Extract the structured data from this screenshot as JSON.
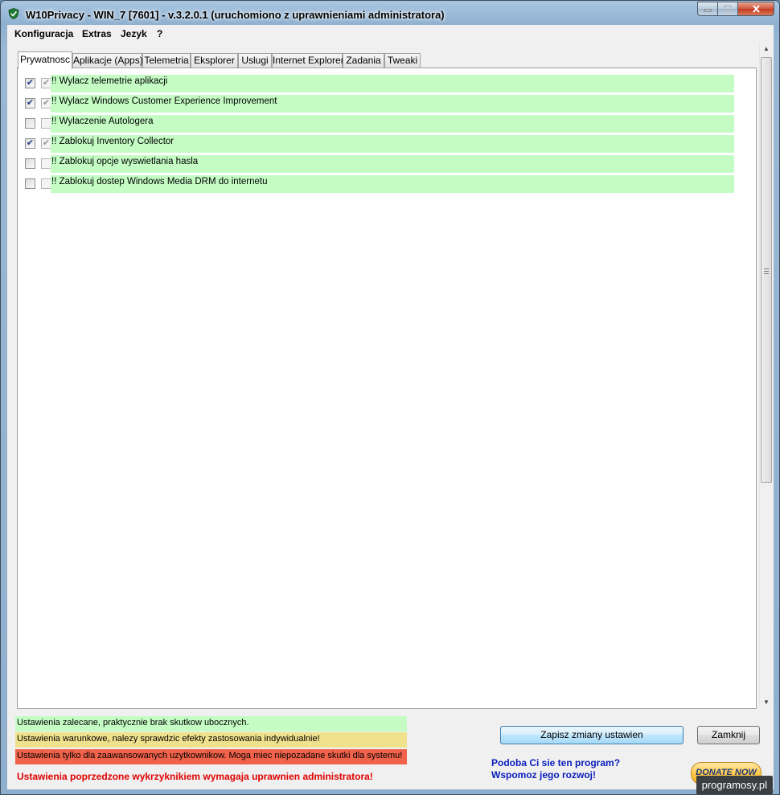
{
  "window": {
    "title": "W10Privacy - WIN_7 [7601]  - v.3.2.0.1 (uruchomiono z uprawnieniami administratora)"
  },
  "menu": [
    "Konfiguracja",
    "Extras",
    "Jezyk",
    "?"
  ],
  "tabs": [
    "Prywatnosc",
    "Aplikacje (Apps)",
    "Telemetria",
    "Eksplorer",
    "Uslugi",
    "Internet Explorer",
    "Zadania",
    "Tweaki"
  ],
  "active_tab": "Prywatnosc",
  "settings": [
    {
      "label": "!! Wylacz telemetrie aplikacji",
      "checked": true,
      "state": true
    },
    {
      "label": "!! Wylacz Windows Customer Experience Improvement",
      "checked": true,
      "state": true
    },
    {
      "label": "!! Wylaczenie Autologera",
      "checked": false,
      "state": false
    },
    {
      "label": "!! Zablokuj Inventory Collector",
      "checked": true,
      "state": true
    },
    {
      "label": "!! Zablokuj opcje wyswietlania hasla",
      "checked": false,
      "state": false
    },
    {
      "label": "!! Zablokuj dostep Windows Media DRM do internetu",
      "checked": false,
      "state": false
    }
  ],
  "row_color": "#c4fcc4",
  "legend": [
    {
      "text": "Ustawienia zalecane, praktycznie brak skutkow ubocznych.",
      "color": "#c4fcc4"
    },
    {
      "text": "Ustawienia warunkowe, nalezy sprawdzic efekty zastosowania indywidualnie!",
      "color": "#f0e18c"
    },
    {
      "text": "Ustawienia tylko dla zaawansowanych uzytkownikow. Moga miec niepozadane skutki dla systemu!",
      "color": "#f0624a"
    }
  ],
  "admin_note": "Ustawienia poprzedzone wykrzyknikiem wymagaja uprawnien administratora!",
  "buttons": {
    "save": "Zapisz zmiany ustawien",
    "close": "Zamknij"
  },
  "promo": {
    "line1": "Podoba Ci sie ten program?",
    "line2": "Wspomoz jego rozwoj!"
  },
  "donate_label": "DONATE NOW",
  "watermark": "programosy.pl"
}
